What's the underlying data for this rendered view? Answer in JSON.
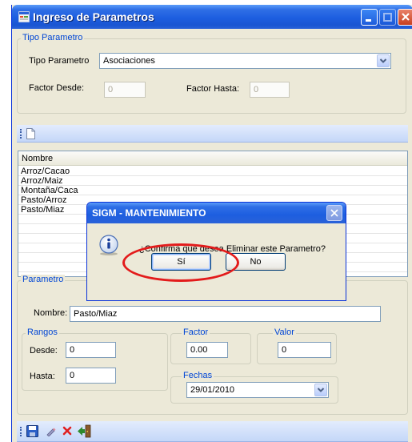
{
  "window": {
    "title": "Ingreso de Parametros"
  },
  "tipo_group": {
    "legend": "Tipo Parametro",
    "tipo_label": "Tipo Parametro",
    "tipo_value": "Asociaciones",
    "factor_desde_label": "Factor Desde:",
    "factor_desde_value": "0",
    "factor_hasta_label": "Factor Hasta:",
    "factor_hasta_value": "0"
  },
  "list": {
    "header": "Nombre",
    "rows": [
      "Arroz/Cacao",
      "Arroz/Maiz",
      "Montaña/Caca",
      "Pasto/Arroz",
      "Pasto/Miaz"
    ]
  },
  "parametro_group": {
    "legend": "Parametro",
    "nombre_label": "Nombre:",
    "nombre_value": "Pasto/Miaz",
    "rangos_legend": "Rangos",
    "desde_label": "Desde:",
    "desde_value": "0",
    "hasta_label": "Hasta:",
    "hasta_value": "0",
    "factor_legend": "Factor",
    "factor_value": "0.00",
    "valor_legend": "Valor",
    "valor_value": "0",
    "fechas_legend": "Fechas",
    "fechas_value": "29/01/2010"
  },
  "dialog": {
    "title": "SIGM - MANTENIMIENTO",
    "message": "¿Confirma que desea Eliminar este Parametro?",
    "yes_label": "Sí",
    "no_label": "No",
    "icon": "info-icon"
  },
  "colors": {
    "titlebar": "#1d5ee0",
    "legend": "#0046d5",
    "highlight_ellipse": "#e31b1b"
  }
}
